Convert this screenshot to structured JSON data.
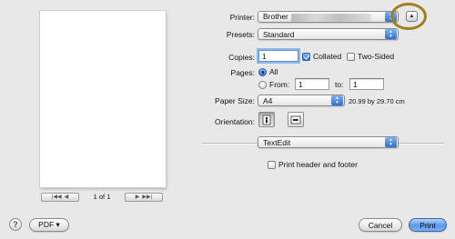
{
  "preview": {
    "page_label": "1 of 1",
    "first_page_icon": "first-page-icon",
    "prev_page_icon": "previous-page-icon",
    "next_page_icon": "next-page-icon",
    "last_page_icon": "last-page-icon"
  },
  "printer": {
    "label": "Printer:",
    "value": "Brother"
  },
  "presets": {
    "label": "Presets:",
    "value": "Standard"
  },
  "copies": {
    "label": "Copies:",
    "value": "1",
    "collated_label": "Collated",
    "collated_checked": true,
    "two_sided_label": "Two-Sided",
    "two_sided_checked": false
  },
  "pages": {
    "label": "Pages:",
    "all_label": "All",
    "from_label": "From:",
    "from_value": "1",
    "to_label": "to:",
    "to_value": "1",
    "selected": "All"
  },
  "paper_size": {
    "label": "Paper Size:",
    "value": "A4",
    "dimensions": "20.99 by 29.70 cm"
  },
  "orientation": {
    "label": "Orientation:",
    "options": [
      "portrait",
      "landscape"
    ],
    "selected": "portrait"
  },
  "app_section": {
    "value": "TextEdit"
  },
  "header_footer": {
    "label": "Print header and footer",
    "checked": false
  },
  "buttons": {
    "help": "?",
    "pdf": "PDF ▾",
    "cancel": "Cancel",
    "print": "Print"
  },
  "colors": {
    "accent_blue": "#2f70d1",
    "highlight_ring": "#a07f1f"
  }
}
